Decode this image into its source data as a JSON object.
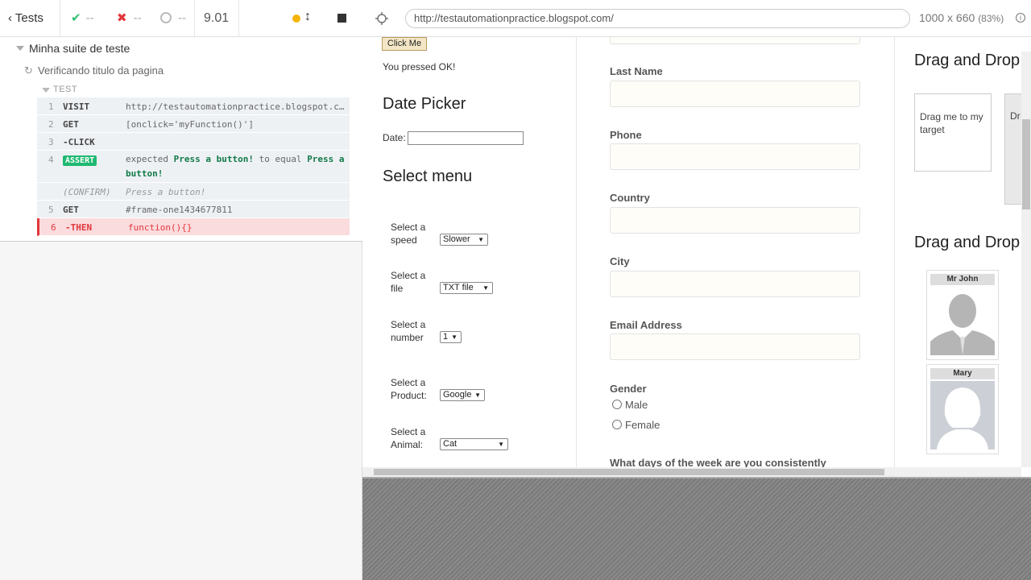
{
  "reporter": {
    "tests_label": "Tests",
    "passed": "--",
    "failed": "--",
    "pending": "--",
    "duration": "9.01",
    "suite_title": "Minha suite de teste",
    "test_title": "Verificando titulo da pagina",
    "test_label": "TEST",
    "commands": [
      {
        "num": "1",
        "name": "VISIT",
        "msg": "http://testautomationpractice.blogspot.c…"
      },
      {
        "num": "2",
        "name": "GET",
        "msg": "[onclick='myFunction()']"
      },
      {
        "num": "3",
        "name": "-CLICK",
        "msg": ""
      },
      {
        "num": "4",
        "name": "ASSERT",
        "msg_expected": "expected",
        "msg_a": "Press a button!",
        "msg_to": "to equal",
        "msg_b": "Press a button!"
      },
      {
        "num": "",
        "name": "(CONFIRM)",
        "msg": "Press a button!"
      },
      {
        "num": "5",
        "name": "GET",
        "msg": "#frame-one1434677811"
      },
      {
        "num": "6",
        "name": "-THEN",
        "msg": "function(){}"
      }
    ]
  },
  "browser": {
    "url": "http://testautomationpractice.blogspot.com/",
    "viewport": "1000 x 660",
    "scale": "(83%)"
  },
  "page": {
    "click_me": "Click Me",
    "pressed_text": "You pressed OK!",
    "date_picker_heading": "Date Picker",
    "date_label": "Date:",
    "select_menu_heading": "Select menu",
    "selects": [
      {
        "label": "Select a speed",
        "value": "Slower"
      },
      {
        "label": "Select a file",
        "value": "TXT file"
      },
      {
        "label": "Select a number",
        "value": "1"
      },
      {
        "label": "Select a Product:",
        "value": "Google"
      },
      {
        "label": "Select a Animal:",
        "value": "Cat"
      }
    ],
    "form": {
      "last_name": "Last Name",
      "phone": "Phone",
      "country": "Country",
      "city": "City",
      "email": "Email Address",
      "gender": "Gender",
      "male": "Male",
      "female": "Female",
      "days": "What days of the week are you consistently"
    },
    "drag_drop_heading": "Drag and Drop",
    "drag_drop_heading2": "Drag and Drop",
    "drag_me": "Drag me to my target",
    "drop_here": "Dr",
    "person1": "Mr John",
    "person2": "Mary"
  }
}
